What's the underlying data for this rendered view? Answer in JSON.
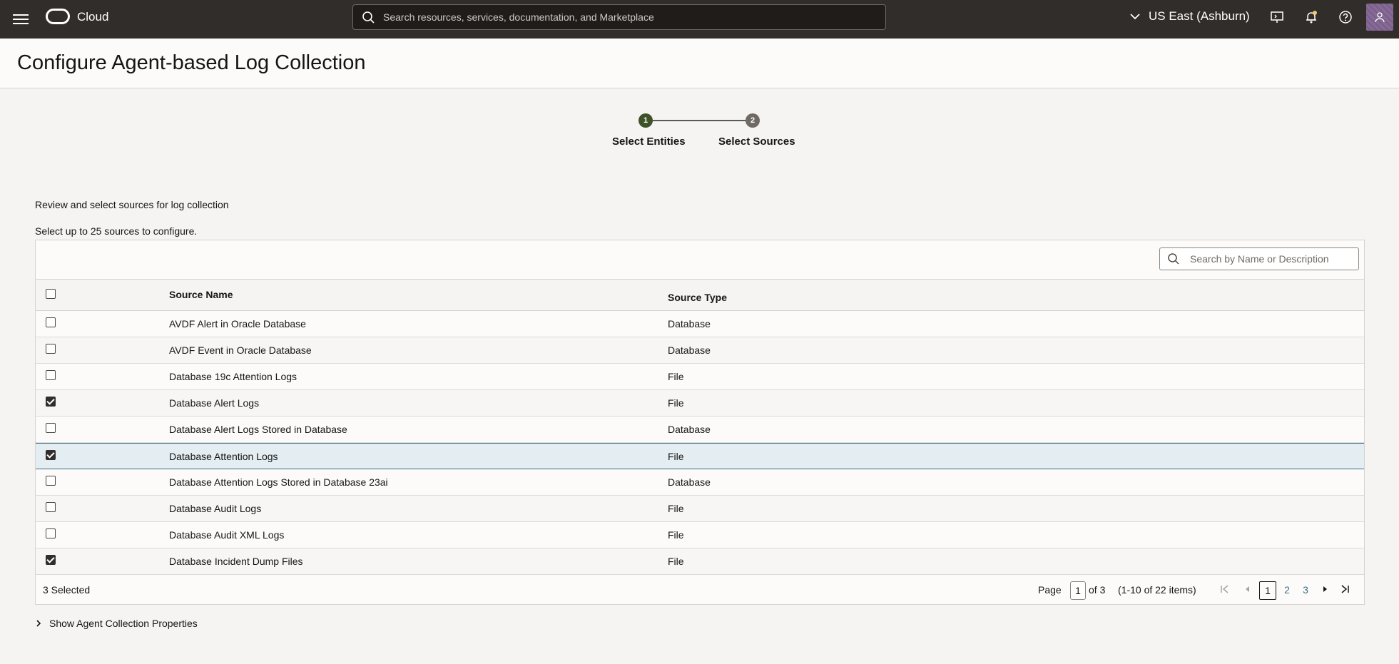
{
  "topbar": {
    "brand": "Cloud",
    "search_placeholder": "Search resources, services, documentation, and Marketplace",
    "region": "US East (Ashburn)"
  },
  "page": {
    "title": "Configure Agent-based Log Collection"
  },
  "stepper": {
    "steps": [
      {
        "number": "1",
        "label": "Select Entities"
      },
      {
        "number": "2",
        "label": "Select Sources"
      }
    ]
  },
  "description": {
    "line1": "Review and select sources for log collection",
    "line2": "Select up to 25 sources to configure."
  },
  "table": {
    "search_placeholder": "Search by Name or Description",
    "headers": {
      "name": "Source Name",
      "type": "Source Type"
    },
    "rows": [
      {
        "name": "AVDF Alert in Oracle Database",
        "type": "Database",
        "checked": false
      },
      {
        "name": "AVDF Event in Oracle Database",
        "type": "Database",
        "checked": false
      },
      {
        "name": "Database 19c Attention Logs",
        "type": "File",
        "checked": false
      },
      {
        "name": "Database Alert Logs",
        "type": "File",
        "checked": true
      },
      {
        "name": "Database Alert Logs Stored in Database",
        "type": "Database",
        "checked": false
      },
      {
        "name": "Database Attention Logs",
        "type": "File",
        "checked": true,
        "highlighted": true
      },
      {
        "name": "Database Attention Logs Stored in Database 23ai",
        "type": "Database",
        "checked": false
      },
      {
        "name": "Database Audit Logs",
        "type": "File",
        "checked": false
      },
      {
        "name": "Database Audit XML Logs",
        "type": "File",
        "checked": false
      },
      {
        "name": "Database Incident Dump Files",
        "type": "File",
        "checked": true
      }
    ],
    "footer": {
      "selected": "3 Selected",
      "page_label": "Page",
      "current_page": "1",
      "of_pages": "of 3",
      "items": "(1-10 of 22 items)",
      "pages": [
        "1",
        "2",
        "3"
      ]
    }
  },
  "show_properties": "Show Agent Collection Properties",
  "colors": {
    "topbar": "#312d2a",
    "step_active": "#3e5229",
    "step_inactive": "#6f6a65",
    "row_highlight": "#e4eef2",
    "link": "#3b6e89"
  }
}
